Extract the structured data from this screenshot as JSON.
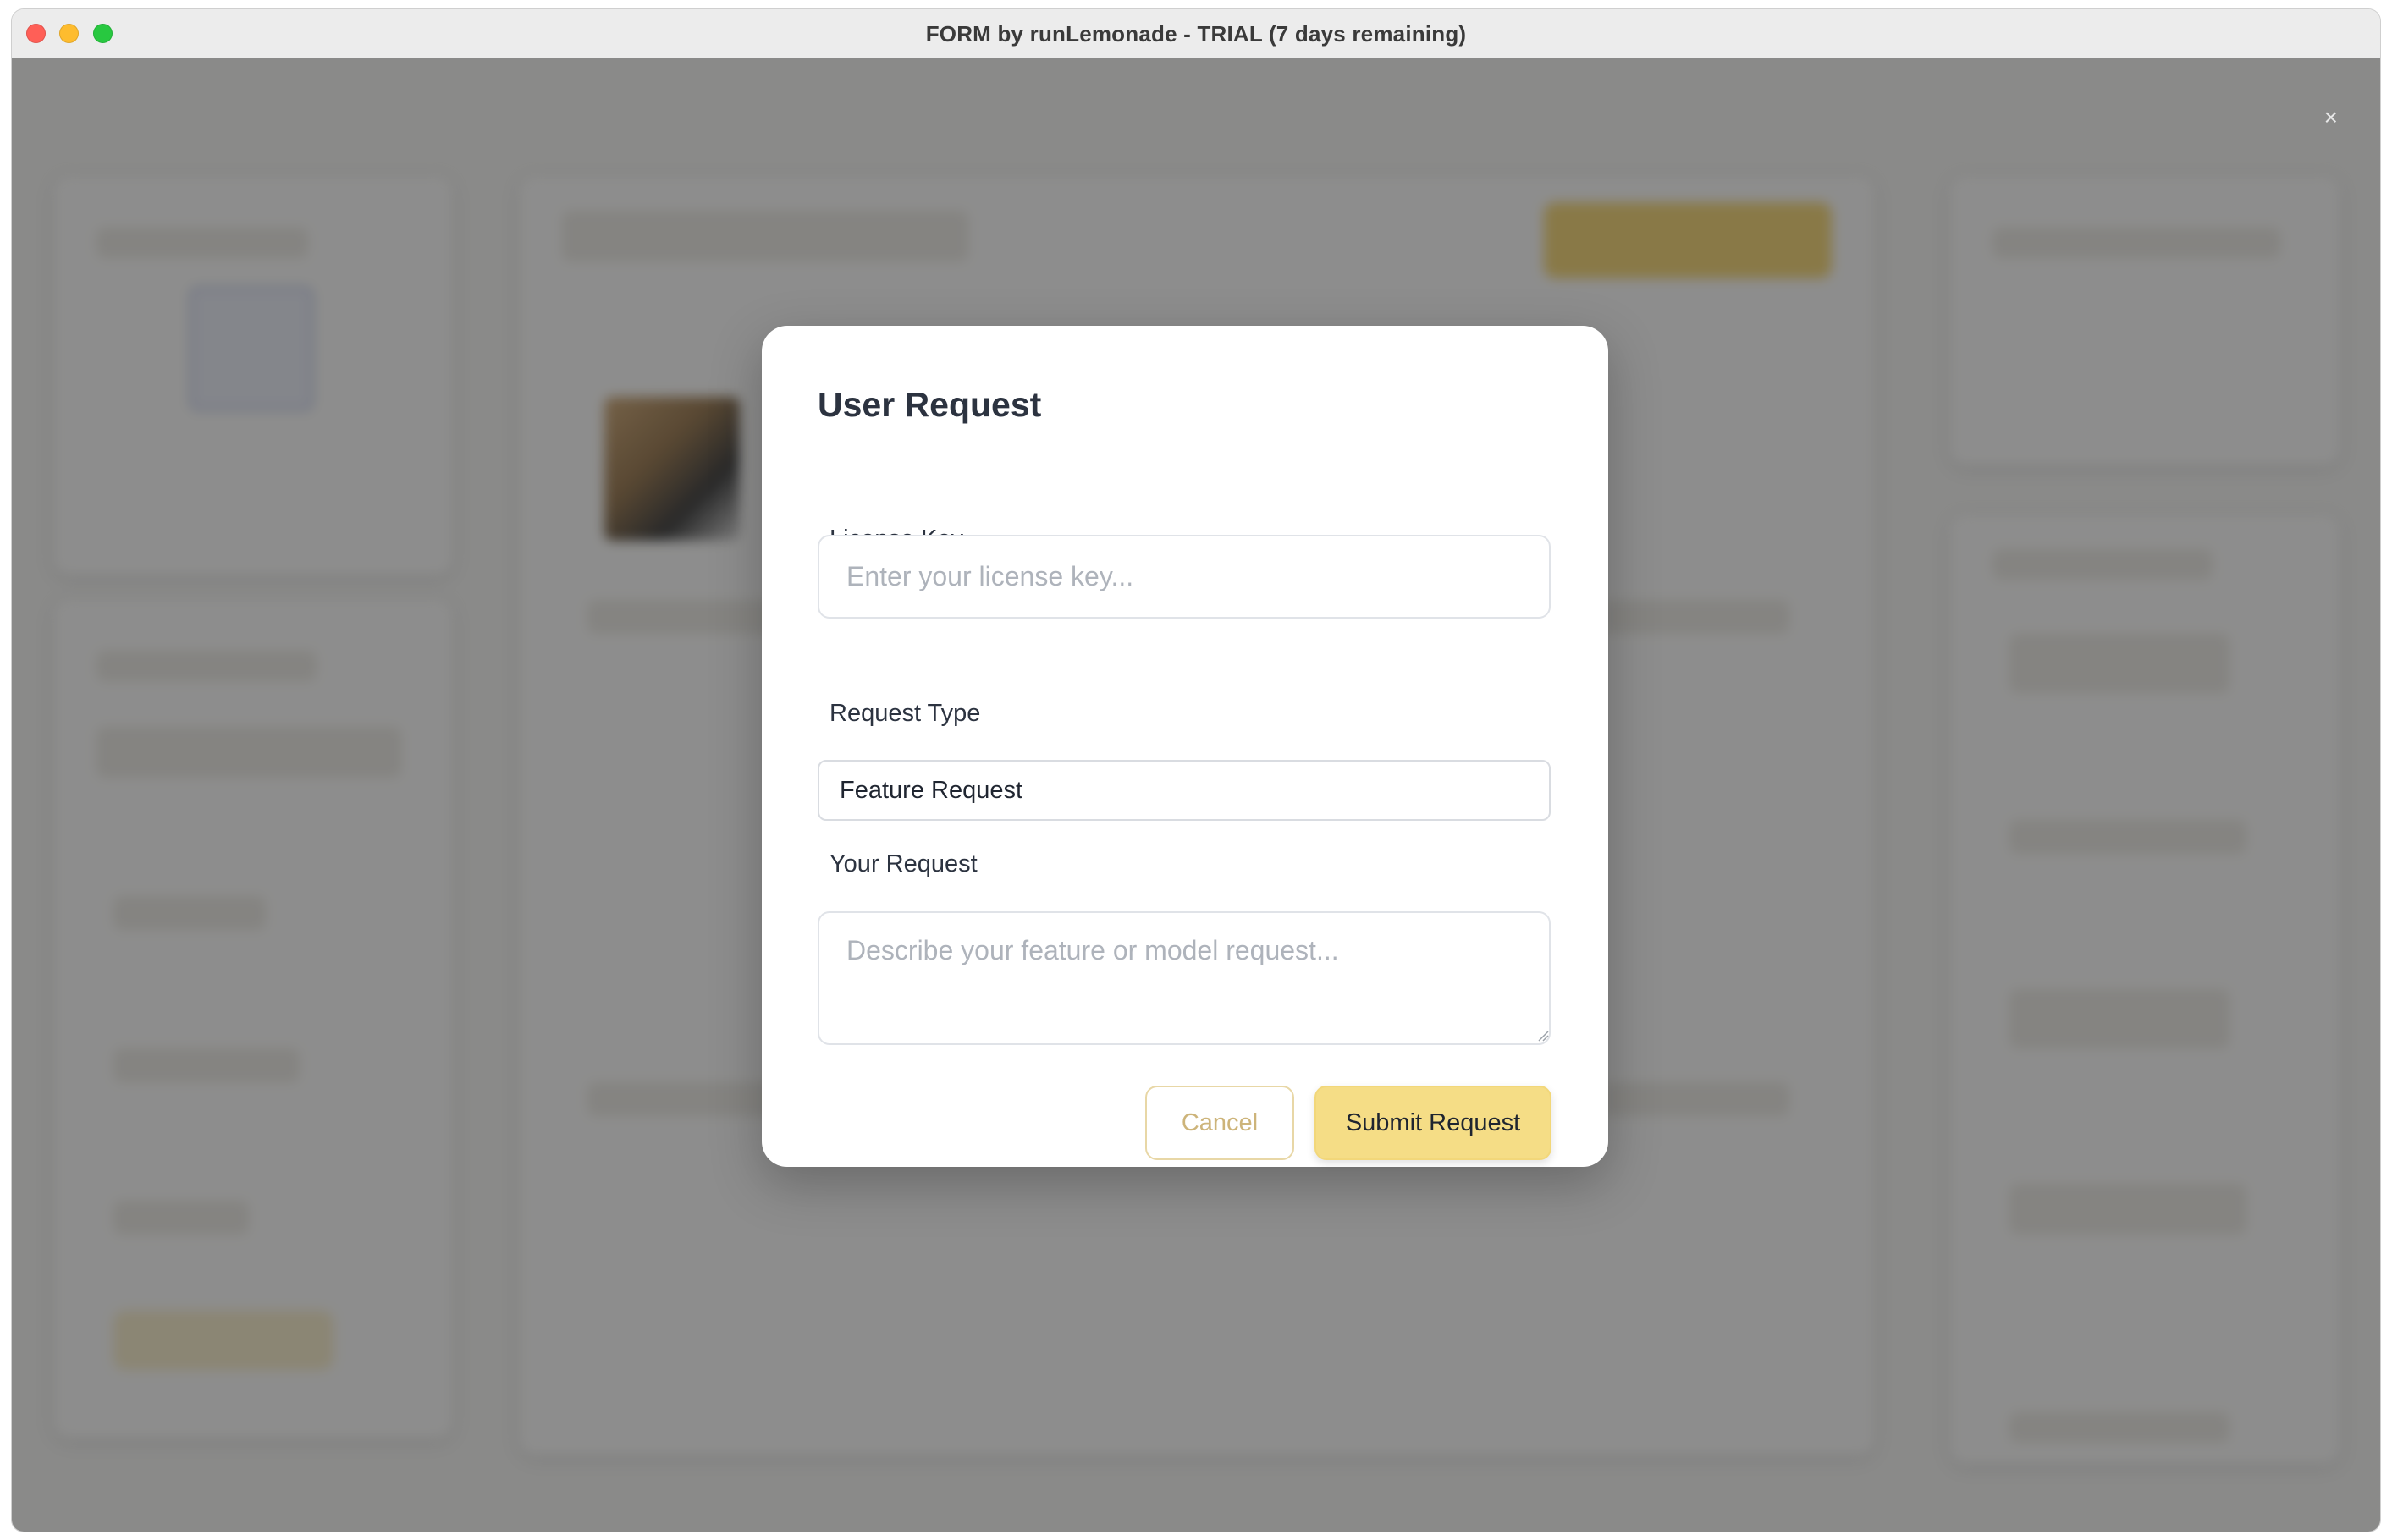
{
  "window": {
    "title": "FORM by runLemonade - TRIAL (7 days remaining)"
  },
  "modal": {
    "title": "User Request",
    "license_label": "License Key",
    "license_placeholder": "Enter your license key...",
    "license_value": "",
    "request_type_label": "Request Type",
    "request_type_selected": "Feature Request",
    "request_label": "Your Request",
    "request_placeholder": "Describe your feature or model request...",
    "request_value": "",
    "cancel_label": "Cancel",
    "submit_label": "Submit Request"
  },
  "overlay": {
    "close_glyph": "×"
  },
  "colors": {
    "accent": "#f5dd86",
    "accent_border": "#e8d7a6",
    "overlay": "rgba(40,40,40,0.52)"
  }
}
